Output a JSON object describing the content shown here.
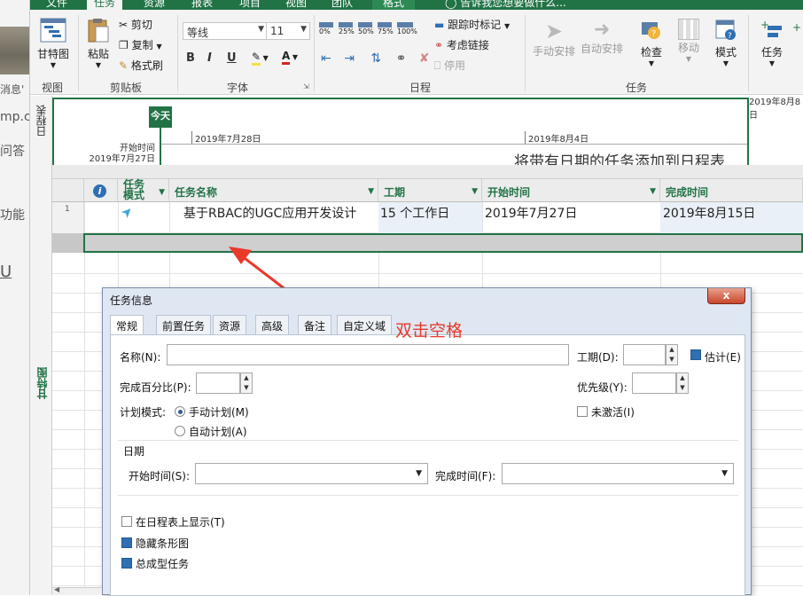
{
  "left_window": {
    "lines": [
      "消息'",
      "mp.c",
      "问答",
      "功能",
      "U"
    ]
  },
  "ribbon_tabs": {
    "file": "文件",
    "task": "任务",
    "resource": "资源",
    "report": "报表",
    "project": "项目",
    "view": "视图",
    "team": "团队",
    "format": "格式",
    "tell_me": "告诉我您想要做什么..."
  },
  "ribbon": {
    "view_group": {
      "label": "视图",
      "gantt_btn": "甘特图"
    },
    "clipboard_group": {
      "label": "剪贴板",
      "paste": "粘贴",
      "cut": "剪切",
      "copy": "复制",
      "format_painter": "格式刷"
    },
    "font_group": {
      "label": "字体",
      "font_name": "等线",
      "font_size": "11",
      "bold": "B",
      "italic": "I",
      "underline": "U"
    },
    "schedule_group": {
      "label": "日程",
      "pct": [
        "0%",
        "25%",
        "50%",
        "75%",
        "100%"
      ],
      "mark_on_track": "跟踪时标记",
      "respect_links": "考虑链接",
      "inactivate": "停用"
    },
    "tasks_group": {
      "label": "任务",
      "manual": "手动安排",
      "auto": "自动安排",
      "inspect": "检查",
      "move": "移动",
      "mode": "模式",
      "task": "任务"
    }
  },
  "timeline": {
    "side_label": "日程表",
    "today": "今天",
    "start_label": "开始时间",
    "start_date": "2019年7月27日",
    "tick1": "2019年7月28日",
    "tick2": "2019年8月4日",
    "tick3": "2019年8月8日",
    "placeholder": "将带有日期的任务添加到日程表"
  },
  "gantt": {
    "side_label": "甘特图",
    "headers": {
      "info": "i",
      "mode_line1": "任务",
      "mode_line2": "模式",
      "name": "任务名称",
      "duration": "工期",
      "start": "开始时间",
      "finish": "完成时间"
    },
    "rows": [
      {
        "id": "1",
        "name": "基于RBAC的UGC应用开发设计",
        "duration": "15 个工作日",
        "start": "2019年7月27日",
        "finish": "2019年8月15日"
      }
    ]
  },
  "annotation": {
    "text": "双击空格",
    "color": "#e8392b"
  },
  "dialog": {
    "title": "任务信息",
    "close": "x",
    "tabs": [
      "常规",
      "前置任务",
      "资源",
      "高级",
      "备注",
      "自定义域"
    ],
    "name_label": "名称(N):",
    "name_value": "",
    "duration_label": "工期(D):",
    "estimated_label": "估计(E)",
    "pct_label": "完成百分比(P):",
    "priority_label": "优先级(Y):",
    "schedule_mode_label": "计划模式:",
    "manual_label": "手动计划(M)",
    "auto_label": "自动计划(A)",
    "inactive_label": "未激活(I)",
    "dates_label": "日期",
    "start_label": "开始时间(S):",
    "finish_label": "完成时间(F):",
    "show_timeline_label": "在日程表上显示(T)",
    "hide_bar_label": "隐藏条形图",
    "summary_label": "总成型任务"
  },
  "colors": {
    "accent": "#217346",
    "arrow": "#e8392b"
  }
}
